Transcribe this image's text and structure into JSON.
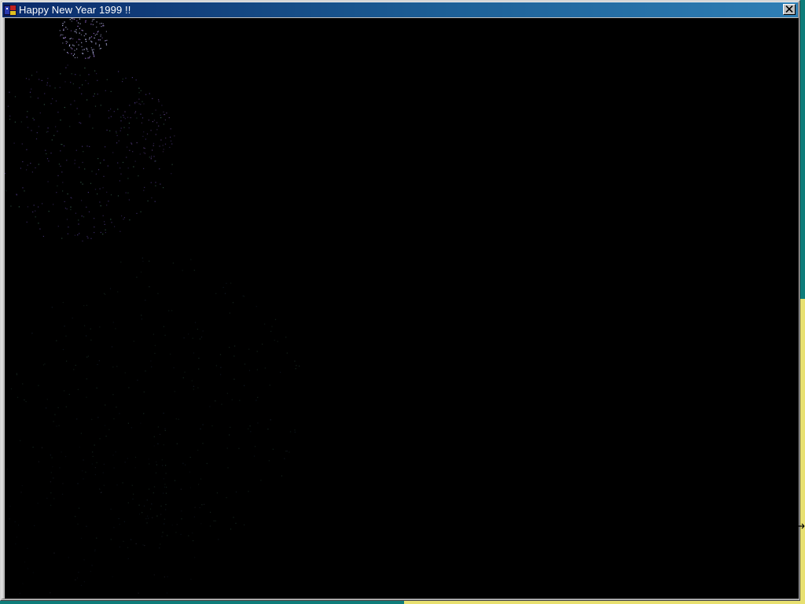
{
  "window": {
    "title": "Happy New Year 1999 !!",
    "app_icon": "app-icon",
    "close_icon": "close-icon"
  },
  "colors": {
    "titlebar_start": "#0a2a6a",
    "titlebar_end": "#2f7fb5",
    "canvas_background": "#000000",
    "desktop_background": "#0e7d7a",
    "firework_colors": [
      "#c8c8ff",
      "#a070e0",
      "#7a5ad0",
      "#5aa080",
      "#4a6a9a"
    ]
  }
}
